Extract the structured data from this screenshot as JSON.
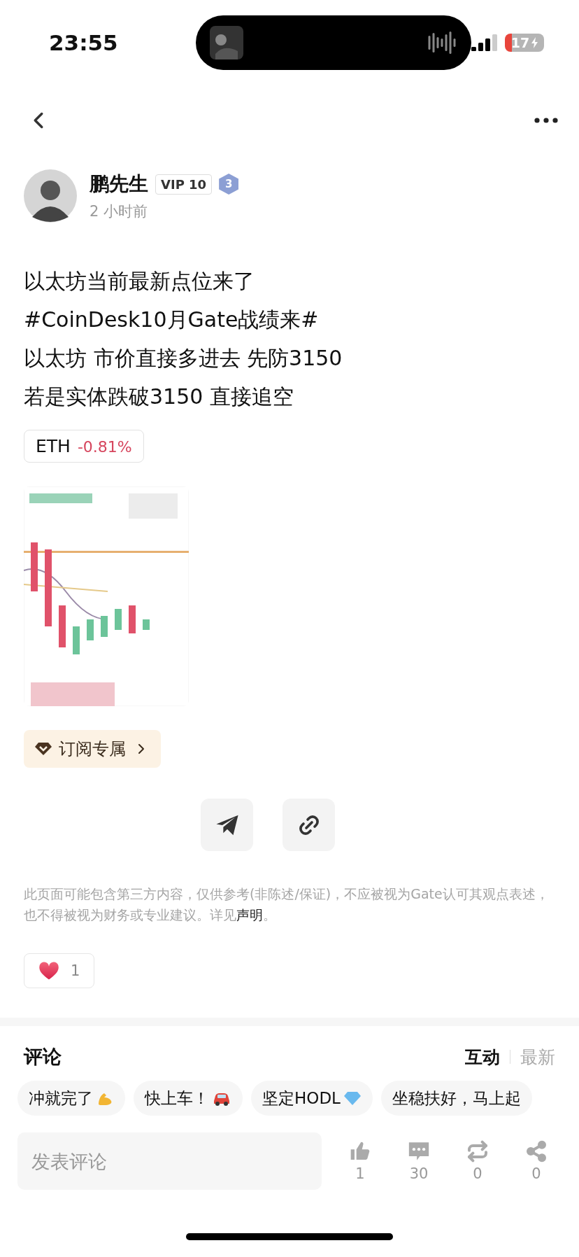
{
  "status_bar": {
    "time": "23:55",
    "battery": "17"
  },
  "author": {
    "name": "鹏先生",
    "vip": "VIP 10",
    "level": "3",
    "time": "2 小时前"
  },
  "post": {
    "lines": [
      "以太坊当前最新点位来了",
      "#CoinDesk10月Gate战绩来#",
      "以太坊 市价直接多进去 先防3150",
      "若是实体跌破3150 直接追空"
    ],
    "ticker": {
      "symbol": "ETH",
      "change": "-0.81%"
    },
    "subscribe": "订阅专属"
  },
  "disclaimer": {
    "text": "此页面可能包含第三方内容，仅供参考(非陈述/保证)，不应被视为Gate认可其观点表述，也不得被视为财务或专业建议。详见",
    "link": "声明",
    "end": "。"
  },
  "like": {
    "count": "1"
  },
  "comments": {
    "title": "评论",
    "sort": [
      {
        "label": "互动",
        "selected": true
      },
      {
        "label": "最新",
        "selected": false
      }
    ]
  },
  "quick_replies": [
    {
      "text": "冲就完了"
    },
    {
      "text": "快上车！"
    },
    {
      "text": "坚定HODL"
    },
    {
      "text": "坐稳扶好，马上起"
    }
  ],
  "comment_box": {
    "placeholder": "发表评论"
  },
  "actions": [
    {
      "kind": "like",
      "count": "1"
    },
    {
      "kind": "comment",
      "count": "30"
    },
    {
      "kind": "repost",
      "count": "0"
    },
    {
      "kind": "share",
      "count": "0"
    }
  ]
}
